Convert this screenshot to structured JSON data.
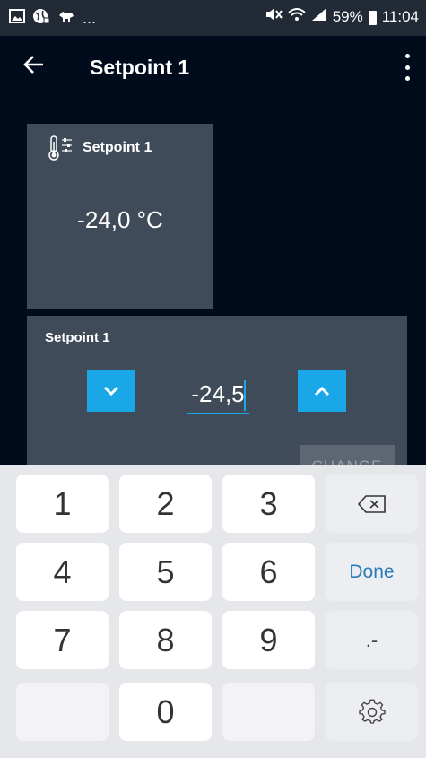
{
  "status_bar": {
    "left_text": "...",
    "battery": "59%",
    "time": "11:04"
  },
  "app_bar": {
    "title": "Setpoint 1"
  },
  "display_card": {
    "title": "Setpoint 1",
    "value": "-24,0 °C"
  },
  "edit_card": {
    "title": "Setpoint 1",
    "input_value": "-24,5",
    "change_button": "CHANGE"
  },
  "keyboard": {
    "keys": [
      "1",
      "2",
      "3",
      "4",
      "5",
      "6",
      "7",
      "8",
      "9",
      "0"
    ],
    "done_label": "Done",
    "dot_label": ".-"
  },
  "colors": {
    "background": "#000b1c",
    "card": "#404b59",
    "accent": "#1aa7e8",
    "keyboard_bg": "#e5e7ea"
  }
}
